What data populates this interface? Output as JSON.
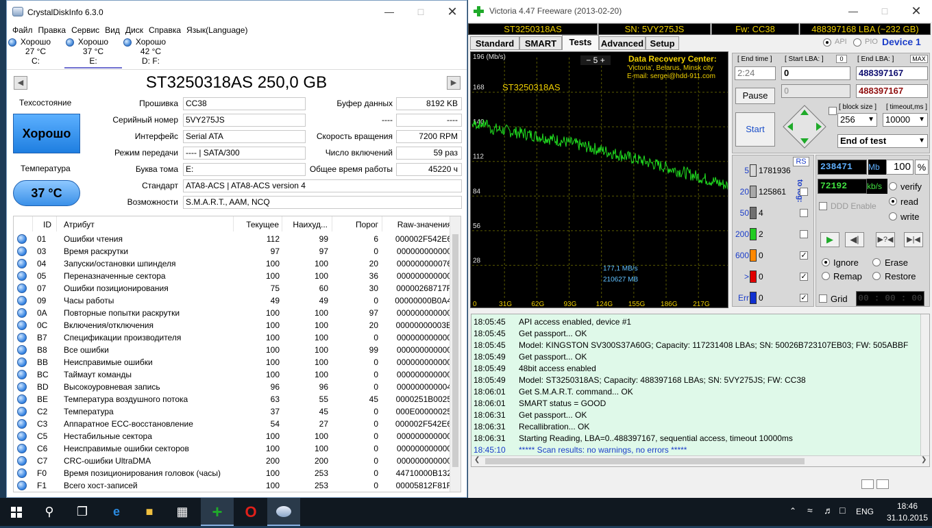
{
  "cdi": {
    "title": "CrystalDiskInfo 6.3.0",
    "menu": [
      "Файл",
      "Правка",
      "Сервис",
      "Вид",
      "Диск",
      "Справка",
      "Язык(Language)"
    ],
    "drives": [
      {
        "status": "Хорошо",
        "temp": "27 °C",
        "letter": "C:"
      },
      {
        "status": "Хорошо",
        "temp": "37 °C",
        "letter": "E:"
      },
      {
        "status": "Хорошо",
        "temp": "42 °C",
        "letter": "D: F:"
      }
    ],
    "model": "ST3250318AS 250,0 GB",
    "health_label": "Техсостояние",
    "health_value": "Хорошо",
    "temp_label": "Температура",
    "temp_value": "37 °C",
    "fields": {
      "firmware_label": "Прошивка",
      "firmware": "CC38",
      "serial_label": "Серийный номер",
      "serial": "5VY275JS",
      "interface_label": "Интерфейс",
      "interface": "Serial ATA",
      "transfer_label": "Режим передачи",
      "transfer": "---- | SATA/300",
      "letter_label": "Буква тома",
      "letter": "E:",
      "standard_label": "Стандарт",
      "standard": "ATA8-ACS | ATA8-ACS version 4",
      "features_label": "Возможности",
      "features": "S.M.A.R.T., AAM, NCQ",
      "buffer_label": "Буфер данных",
      "buffer": "8192 KB",
      "blank_label": "----",
      "blank": "----",
      "rpm_label": "Скорость вращения",
      "rpm": "7200 RPM",
      "powercount_label": "Число включений",
      "powercount": "59 раз",
      "powerhours_label": "Общее время работы",
      "powerhours": "45220 ч"
    },
    "columns": [
      "ID",
      "Атрибут",
      "Текущее",
      "Наихуд...",
      "Порог",
      "Raw-значения"
    ],
    "rows": [
      [
        "01",
        "Ошибки чтения",
        "112",
        "99",
        "6",
        "000002F542E6"
      ],
      [
        "03",
        "Время раскрутки",
        "97",
        "97",
        "0",
        "000000000000"
      ],
      [
        "04",
        "Запуски/остановки шпинделя",
        "100",
        "100",
        "20",
        "000000000076"
      ],
      [
        "05",
        "Переназначенные сектора",
        "100",
        "100",
        "36",
        "000000000000"
      ],
      [
        "07",
        "Ошибки позиционирования",
        "75",
        "60",
        "30",
        "00000268717F"
      ],
      [
        "09",
        "Часы работы",
        "49",
        "49",
        "0",
        "00000000B0A4"
      ],
      [
        "0A",
        "Повторные попытки раскрутки",
        "100",
        "100",
        "97",
        "000000000000"
      ],
      [
        "0C",
        "Включения/отключения",
        "100",
        "100",
        "20",
        "00000000003B"
      ],
      [
        "B7",
        "Спецификации производителя",
        "100",
        "100",
        "0",
        "000000000000"
      ],
      [
        "B8",
        "Все ошибки",
        "100",
        "100",
        "99",
        "000000000000"
      ],
      [
        "BB",
        "Неисправимые ошибки",
        "100",
        "100",
        "0",
        "000000000000"
      ],
      [
        "BC",
        "Таймаут команды",
        "100",
        "100",
        "0",
        "000000000000"
      ],
      [
        "BD",
        "Высокоуровневая запись",
        "96",
        "96",
        "0",
        "000000000004"
      ],
      [
        "BE",
        "Температура воздушного потока",
        "63",
        "55",
        "45",
        "0000251B0025"
      ],
      [
        "C2",
        "Температура",
        "37",
        "45",
        "0",
        "000E00000025"
      ],
      [
        "C3",
        "Аппаратное ECC-восстановление",
        "54",
        "27",
        "0",
        "000002F542E6"
      ],
      [
        "C5",
        "Нестабильные сектора",
        "100",
        "100",
        "0",
        "000000000000"
      ],
      [
        "C6",
        "Неисправимые ошибки секторов",
        "100",
        "100",
        "0",
        "000000000000"
      ],
      [
        "C7",
        "CRC-ошибки UltraDMA",
        "200",
        "200",
        "0",
        "000000000000"
      ],
      [
        "F0",
        "Время позиционирования головок (часы)",
        "100",
        "253",
        "0",
        "44710000B132"
      ],
      [
        "F1",
        "Всего хост-записей",
        "100",
        "253",
        "0",
        "00005812F81F"
      ]
    ]
  },
  "victoria": {
    "title": "Victoria 4.47  Freeware (2013-02-20)",
    "info": {
      "model": "ST3250318AS",
      "sn": "SN: 5VY275JS",
      "fw": "Fw: CC38",
      "lba": "488397168 LBA (~232 GB)"
    },
    "tabs": [
      "Standard",
      "SMART",
      "Tests",
      "Advanced",
      "Setup"
    ],
    "api_label": "API",
    "pio_label": "PIO",
    "device_label": "Device 1",
    "graph": {
      "unit": "196 (Mb/s)",
      "y_ticks": [
        "168",
        "140",
        "112",
        "84",
        "56",
        "28"
      ],
      "x_ticks": [
        "0",
        "31G",
        "62G",
        "93G",
        "124G",
        "155G",
        "186G",
        "217G"
      ],
      "model": "ST3250318AS",
      "scale": "5",
      "recovery": [
        "Data Recovery Center:",
        "'Victoria', Belarus, Minsk city",
        "E-mail: sergei@hdd-911.com"
      ],
      "speed": "177,1 MB/s",
      "size": "210627 MB"
    },
    "end_time_label": "[ End time ]",
    "end_time": "2:24",
    "start_lba_label": "[ Start LBA: ]",
    "start_lba_zero": "0",
    "start_lba": "0",
    "start_lba2": "0",
    "end_lba_label": "[ End LBA: ]",
    "end_lba_max": "MAX",
    "end_lba": "488397167",
    "end_lba2": "488397167",
    "pause_label": "Pause",
    "start_label": "Start",
    "block_size_label": "[ block size ]",
    "block_size": "256",
    "timeout_label": "[ timeout,ms ]",
    "timeout": "10000",
    "end_mode": "End of test",
    "rs_label": "RS",
    "to_log_label": "to log:",
    "legend": [
      {
        "label": "5",
        "count": "1781936",
        "color": "#d8d8d8",
        "checked": ""
      },
      {
        "label": "20",
        "count": "125861",
        "color": "#a8a8a8",
        "checked": ""
      },
      {
        "label": "50",
        "count": "4",
        "color": "#707070",
        "checked": ""
      },
      {
        "label": "200",
        "count": "2",
        "color": "#22cc22",
        "checked": ""
      },
      {
        "label": "600",
        "count": "0",
        "color": "#ff8800",
        "checked": "✓"
      },
      {
        "label": ">",
        "count": "0",
        "color": "#e00000",
        "checked": "✓"
      },
      {
        "label": "Err",
        "count": "0",
        "color": "#1030d0",
        "checked": "✓"
      }
    ],
    "mb_value": "238471",
    "mb_unit": "Mb",
    "percent": "100",
    "percent_unit": "%",
    "kbs_value": "72192",
    "kbs_unit": "kb/s",
    "verify_label": "verify",
    "read_label": "read",
    "write_label": "write",
    "ddd_label": "DDD Enable",
    "ignore_label": "Ignore",
    "erase_label": "Erase",
    "remap_label": "Remap",
    "restore_label": "Restore",
    "grid_label": "Grid",
    "grid_time": "00 : 00 : 00",
    "log": [
      {
        "time": "18:05:45",
        "msg": "API access enabled, device #1",
        "blue": false
      },
      {
        "time": "18:05:45",
        "msg": "Get passport... OK",
        "blue": false
      },
      {
        "time": "18:05:45",
        "msg": "Model: KINGSTON SV300S37A60G; Capacity: 117231408 LBAs; SN: 50026B723107EB03; FW: 505ABBF",
        "blue": false
      },
      {
        "time": "18:05:49",
        "msg": "Get passport... OK",
        "blue": false
      },
      {
        "time": "18:05:49",
        "msg": "48bit access enabled",
        "blue": false
      },
      {
        "time": "18:05:49",
        "msg": "Model: ST3250318AS; Capacity: 488397168 LBAs; SN: 5VY275JS; FW: CC38",
        "blue": false
      },
      {
        "time": "18:06:01",
        "msg": "Get S.M.A.R.T. command... OK",
        "blue": false
      },
      {
        "time": "18:06:01",
        "msg": "SMART status = GOOD",
        "blue": false
      },
      {
        "time": "18:06:31",
        "msg": "Get passport... OK",
        "blue": false
      },
      {
        "time": "18:06:31",
        "msg": "Recallibration... OK",
        "blue": false
      },
      {
        "time": "18:06:31",
        "msg": "Starting Reading, LBA=0..488397167, sequential access, timeout 10000ms",
        "blue": false
      },
      {
        "time": "18:45:10",
        "msg": "***** Scan results: no warnings, no errors *****",
        "blue": true
      }
    ]
  },
  "taskbar": {
    "lang": "ENG",
    "time": "18:46",
    "date": "31.10.2015"
  }
}
